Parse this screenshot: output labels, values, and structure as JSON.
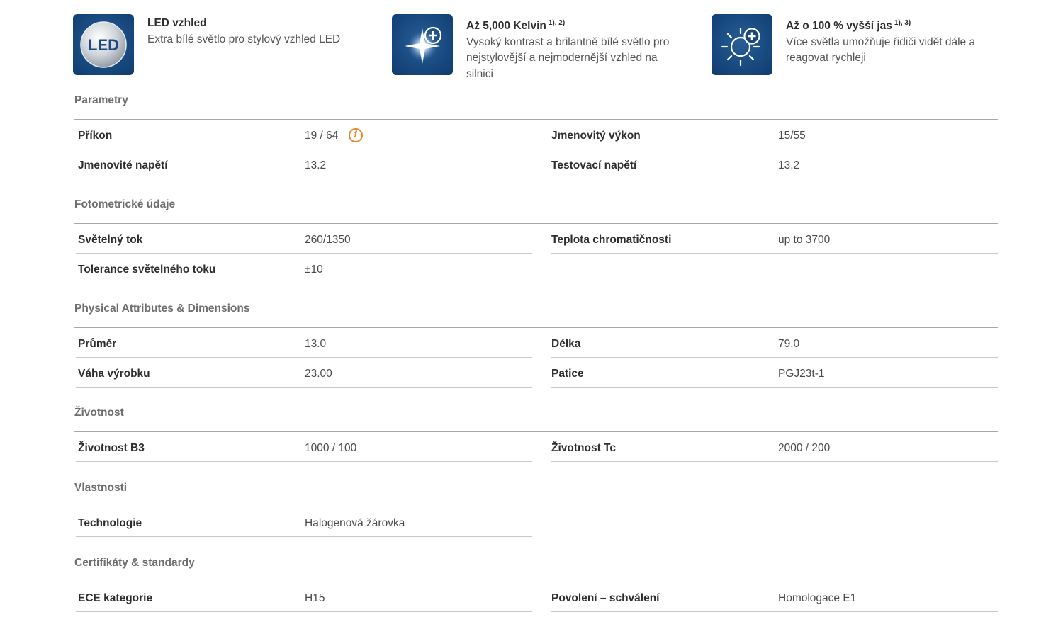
{
  "features": [
    {
      "icon": "led-badge-icon",
      "icon_text": "LED",
      "title": "LED vzhled",
      "sup": "",
      "desc": "Extra bílé světlo pro stylový vzhled LED"
    },
    {
      "icon": "sparkle-plus-icon",
      "title": "Až 5,000 Kelvin",
      "sup": "1), 2)",
      "desc": "Vysoký kontrast a brilantně bílé světlo pro nejstylovější a nejmodernější vzhled na silnici"
    },
    {
      "icon": "bright-sun-plus-icon",
      "title": "Až o 100 % vyšší jas",
      "sup": "1), 3)",
      "desc": "Více světla umožňuje řidiči vidět dále a reagovat rychleji"
    }
  ],
  "sections": [
    {
      "title": "Parametry",
      "rows": [
        {
          "left": {
            "label": "Příkon",
            "value": "19 / 64",
            "info": true
          },
          "right": {
            "label": "Jmenovitý výkon",
            "value": "15/55"
          }
        },
        {
          "left": {
            "label": "Jmenovité napětí",
            "value": "13.2"
          },
          "right": {
            "label": "Testovací napětí",
            "value": "13,2"
          }
        }
      ]
    },
    {
      "title": "Fotometrické údaje",
      "rows": [
        {
          "left": {
            "label": "Světelný tok",
            "value": "260/1350"
          },
          "right": {
            "label": "Teplota chromatičnosti",
            "value": "up to 3700"
          }
        },
        {
          "left": {
            "label": "Tolerance světelného toku",
            "value": "±10"
          }
        }
      ]
    },
    {
      "title": "Physical Attributes & Dimensions",
      "rows": [
        {
          "left": {
            "label": "Průměr",
            "value": "13.0"
          },
          "right": {
            "label": "Délka",
            "value": "79.0"
          }
        },
        {
          "left": {
            "label": "Váha výrobku",
            "value": "23.00"
          },
          "right": {
            "label": "Patice",
            "value": "PGJ23t-1"
          }
        }
      ]
    },
    {
      "title": "Životnost",
      "rows": [
        {
          "left": {
            "label": "Životnost B3",
            "value": "1000 / 100"
          },
          "right": {
            "label": "Životnost Tc",
            "value": "2000 / 200"
          }
        }
      ]
    },
    {
      "title": "Vlastnosti",
      "rows": [
        {
          "left": {
            "label": "Technologie",
            "value": "Halogenová žárovka"
          }
        }
      ]
    },
    {
      "title": "Certifikáty & standardy",
      "rows": [
        {
          "left": {
            "label": "ECE kategorie",
            "value": "H15"
          },
          "right": {
            "label": "Povolení – schválení",
            "value": "Homologace E1"
          }
        }
      ]
    }
  ],
  "colors": {
    "icon_tile": "#17497f",
    "info_icon": "#e8892b",
    "section_title": "#6e6e6e"
  }
}
